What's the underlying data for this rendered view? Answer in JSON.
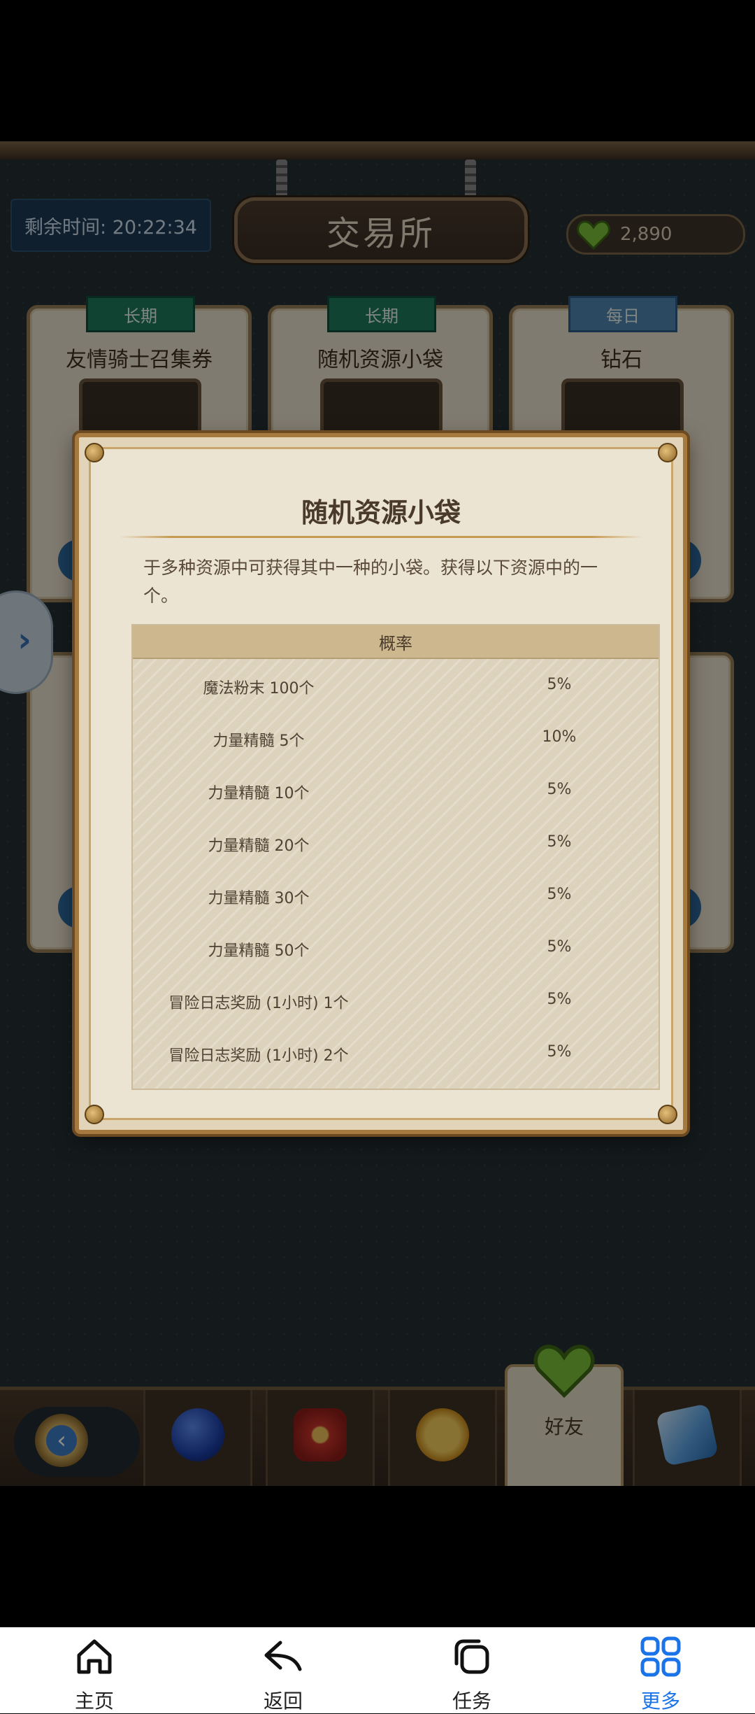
{
  "game": {
    "title": "交易所",
    "timer": "剩余时间: 20:22:34",
    "currency": "2,890",
    "cards": [
      {
        "tag": "长期",
        "title": "友情骑士召集券"
      },
      {
        "tag": "长期",
        "title": "随机资源小袋"
      },
      {
        "tag": "每日",
        "title": "钻石"
      }
    ],
    "side_arrow": "›"
  },
  "dialog": {
    "title": "随机资源小袋",
    "description": "于多种资源中可获得其中一种的小袋。获得以下资源中的一个。",
    "column_header": "概率",
    "rows": [
      {
        "name": "魔法粉末 100个",
        "rate": "5%"
      },
      {
        "name": "力量精髓 5个",
        "rate": "10%"
      },
      {
        "name": "力量精髓 10个",
        "rate": "5%"
      },
      {
        "name": "力量精髓 20个",
        "rate": "5%"
      },
      {
        "name": "力量精髓 30个",
        "rate": "5%"
      },
      {
        "name": "力量精髓 50个",
        "rate": "5%"
      },
      {
        "name": "冒险日志奖励 (1小时) 1个",
        "rate": "5%"
      },
      {
        "name": "冒险日志奖励 (1小时) 2个",
        "rate": "5%"
      }
    ]
  },
  "bottom_bar": {
    "back_glyph": "‹",
    "friend_label": "好友"
  },
  "system_nav": {
    "home": "主页",
    "back": "返回",
    "tasks": "任务",
    "more": "更多"
  },
  "colors": {
    "accent_blue": "#1a73e8",
    "green_tag": "#1e7a5a",
    "daily_tag": "#4f86b0"
  }
}
